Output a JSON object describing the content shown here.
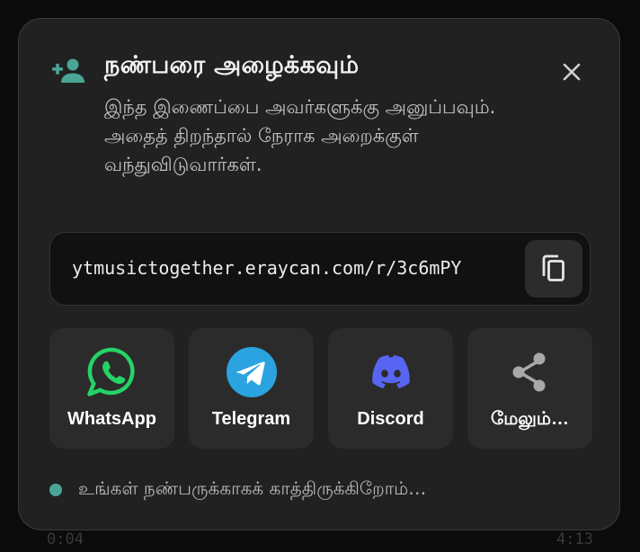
{
  "background": {
    "time_left": "0:04",
    "time_right": "4:13"
  },
  "dialog": {
    "title": "நண்பரை அழைக்கவும்",
    "description": "இந்த இணைப்பை அவர்களுக்கு அனுப்பவும். அதைத் திறந்தால் நேராக அறைக்குள் வந்துவிடுவார்கள்.",
    "header_icon": "person-add-icon",
    "close_icon": "close-icon",
    "accent_color": "#4aa596"
  },
  "link": {
    "url": "ytmusictogether.eraycan.com/r/3c6mPY",
    "copy_icon": "copy-icon"
  },
  "share": [
    {
      "label": "WhatsApp",
      "icon": "whatsapp-icon",
      "color": "#25d366"
    },
    {
      "label": "Telegram",
      "icon": "telegram-icon",
      "color": "#2aa3e0"
    },
    {
      "label": "Discord",
      "icon": "discord-icon",
      "color": "#5865f2"
    },
    {
      "label": "மேலும்…",
      "icon": "share-icon",
      "color": "#a8a8a8"
    }
  ],
  "status": {
    "text": "உங்கள் நண்பருக்காகக் காத்திருக்கிறோம்…"
  }
}
